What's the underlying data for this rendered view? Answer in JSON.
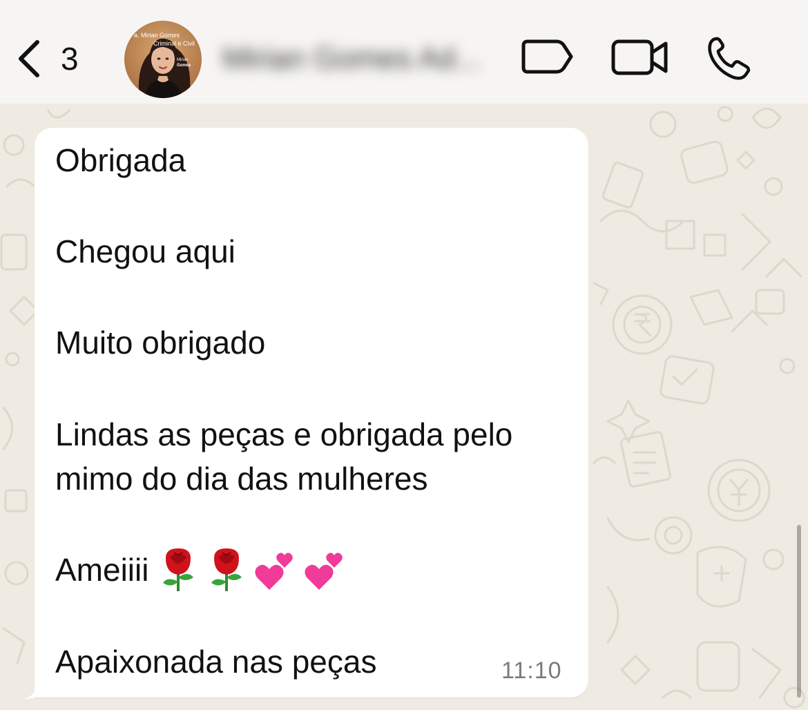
{
  "header": {
    "unread_count": "3",
    "contact_name": "Mirian Gomes Ad...",
    "avatar": {
      "caption_line1": "a. Mirian Gomes",
      "caption_line2": "Criminal e Civil",
      "caption_line3": "Mirian",
      "caption_line4": "Gomes"
    },
    "icons": {
      "back": "chevron-left-icon",
      "label": "label-tag-icon",
      "video": "video-camera-icon",
      "call": "phone-icon"
    }
  },
  "chat": {
    "message": {
      "lines": [
        "Obrigada",
        "Chegou aqui",
        "Muito obrigado",
        "Lindas as peças e obrigada pelo",
        "mimo do dia das mulheres",
        "Ameiiii",
        "Apaixonada nas peças"
      ],
      "emojis": [
        "rose-emoji",
        "rose-emoji",
        "two-hearts-emoji",
        "two-hearts-emoji"
      ],
      "time": "11:10"
    }
  },
  "colors": {
    "header_bg": "#f6f5f3",
    "wallpaper_bg": "#efeae2",
    "bubble_bg": "#ffffff",
    "text": "#111111",
    "timestamp": "#7b7b7b"
  }
}
